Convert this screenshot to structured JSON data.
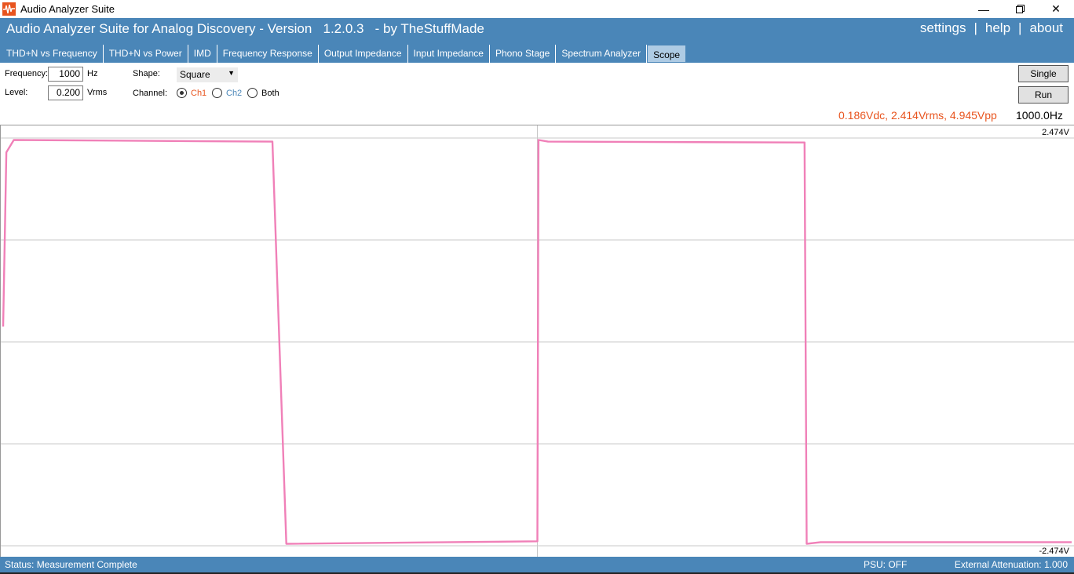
{
  "window": {
    "title": "Audio Analyzer Suite"
  },
  "header": {
    "app_title": "Audio Analyzer Suite for Analog Discovery - Version   1.2.0.3   - by TheStuffMade",
    "links": {
      "settings": "settings",
      "help": "help",
      "about": "about",
      "separator": "|"
    }
  },
  "tabs": [
    {
      "label": "THD+N vs Frequency"
    },
    {
      "label": "THD+N vs Power"
    },
    {
      "label": "IMD"
    },
    {
      "label": "Frequency Response"
    },
    {
      "label": "Output Impedance"
    },
    {
      "label": "Input Impedance"
    },
    {
      "label": "Phono Stage"
    },
    {
      "label": "Spectrum Analyzer"
    },
    {
      "label": "Scope",
      "active": true
    }
  ],
  "controls": {
    "frequency_label": "Frequency:",
    "frequency_value": "1000",
    "frequency_unit": "Hz",
    "level_label": "Level:",
    "level_value": "0.200",
    "level_unit": "Vrms",
    "shape_label": "Shape:",
    "shape_value": "Square",
    "channel_label": "Channel:",
    "channel_options": {
      "ch1": "Ch1",
      "ch2": "Ch2",
      "both": "Both"
    },
    "channel_selected": "ch1",
    "single_label": "Single",
    "run_label": "Run"
  },
  "readout": {
    "measurement": "0.186Vdc, 2.414Vrms, 4.945Vpp",
    "frequency": "1000.0Hz"
  },
  "chart_data": {
    "type": "line",
    "series": [
      {
        "x": [
          0.0,
          0.003,
          0.01,
          0.25,
          0.252,
          0.265,
          0.5,
          0.501,
          0.51,
          0.75,
          0.752,
          0.765,
          1.0
        ],
        "y": [
          0.186,
          2.3,
          2.45,
          2.43,
          2.43,
          -2.45,
          -2.42,
          2.45,
          2.43,
          2.42,
          -2.45,
          -2.43,
          -2.43
        ]
      }
    ],
    "ylim": [
      -2.474,
      2.474
    ],
    "y_labels": {
      "max": "2.474V",
      "min": "-2.474V"
    },
    "grid": true,
    "colors": {
      "trace": "#f080b8",
      "grid": "#c8c8c8",
      "ch1_label": "#e8541e",
      "ch2_label": "#4a86b8",
      "readout": "#e8541e"
    }
  },
  "status": {
    "text": "Status: Measurement Complete",
    "psu": "PSU: OFF",
    "attenuation": "External Attenuation: 1.000"
  }
}
